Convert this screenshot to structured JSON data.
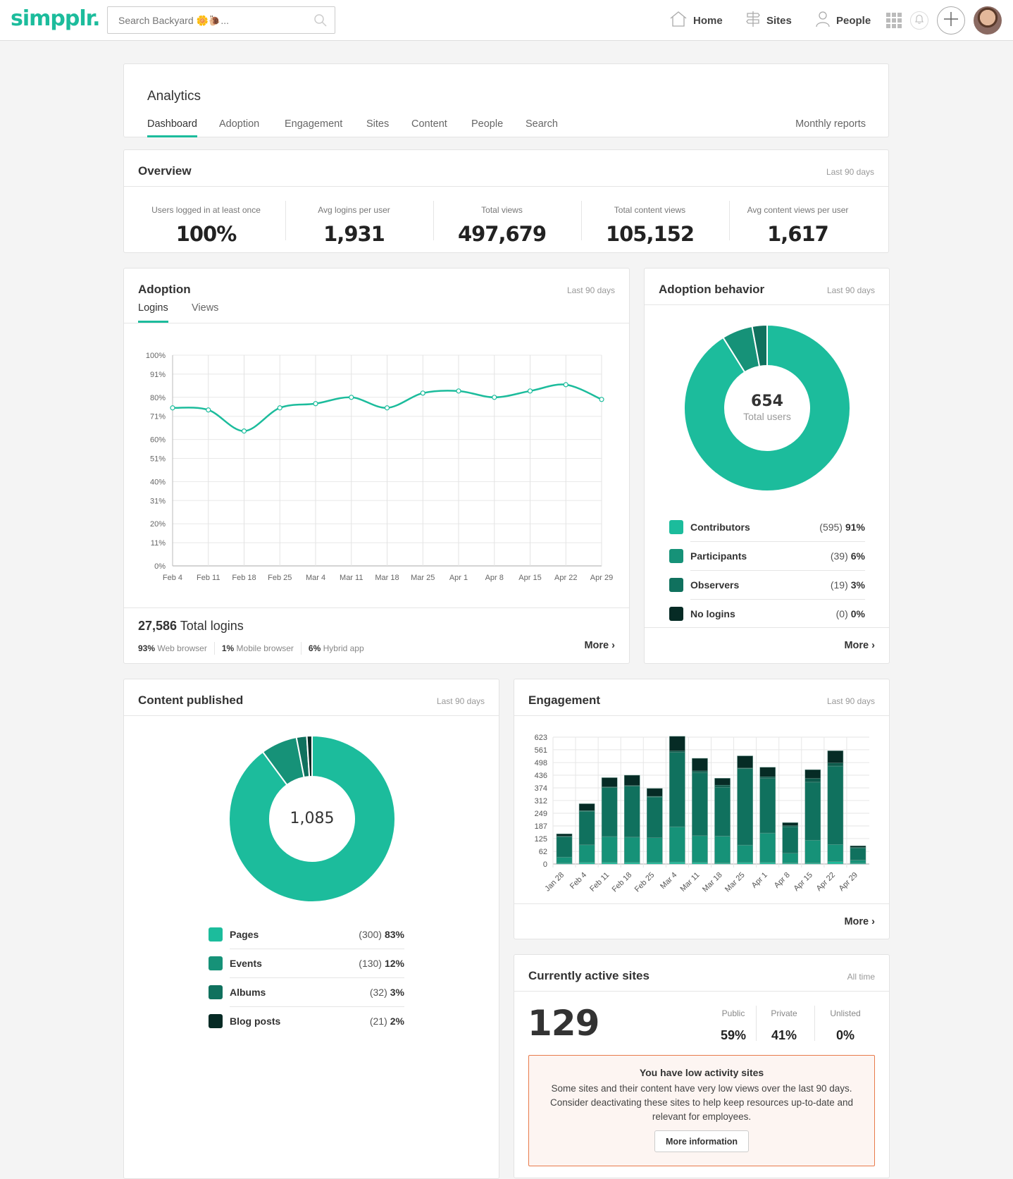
{
  "header": {
    "logo": "simpplr.",
    "search_placeholder": "Search Backyard 🌼🐌...",
    "nav": [
      {
        "label": "Home",
        "icon": "home-icon"
      },
      {
        "label": "Sites",
        "icon": "signpost-icon"
      },
      {
        "label": "People",
        "icon": "person-icon"
      }
    ]
  },
  "analytics": {
    "title": "Analytics",
    "tabs": [
      "Dashboard",
      "Adoption",
      "Engagement",
      "Sites",
      "Content",
      "People",
      "Search"
    ],
    "active_tab": "Dashboard",
    "monthly_reports": "Monthly reports"
  },
  "overview": {
    "title": "Overview",
    "period": "Last 90 days",
    "stats": [
      {
        "label": "Users logged in at least once",
        "value": "100%"
      },
      {
        "label": "Avg logins per user",
        "value": "1,931"
      },
      {
        "label": "Total views",
        "value": "497,679"
      },
      {
        "label": "Total content views",
        "value": "105,152"
      },
      {
        "label": "Avg content views per user",
        "value": "1,617"
      }
    ]
  },
  "adoption": {
    "title": "Adoption",
    "period": "Last 90 days",
    "tabs": [
      "Logins",
      "Views"
    ],
    "active_tab": "Logins",
    "total_value": "27,586",
    "total_label": "Total logins",
    "breakdown": [
      {
        "pct": "93%",
        "label": "Web browser"
      },
      {
        "pct": "1%",
        "label": "Mobile browser"
      },
      {
        "pct": "6%",
        "label": "Hybrid app"
      }
    ],
    "more": "More"
  },
  "adoption_behavior": {
    "title": "Adoption behavior",
    "period": "Last 90 days",
    "center_value": "654",
    "center_label": "Total users",
    "items": [
      {
        "name": "Contributors",
        "count": "(595)",
        "pct": "91%"
      },
      {
        "name": "Participants",
        "count": "(39)",
        "pct": "6%"
      },
      {
        "name": "Observers",
        "count": "(19)",
        "pct": "3%"
      },
      {
        "name": "No logins",
        "count": "(0)",
        "pct": "0%"
      }
    ],
    "more": "More"
  },
  "content_published": {
    "title": "Content published",
    "period": "Last 90 days",
    "center_value": "1,085",
    "items": [
      {
        "name": "Pages",
        "count": "(300)",
        "pct": "83%"
      },
      {
        "name": "Events",
        "count": "(130)",
        "pct": "12%"
      },
      {
        "name": "Albums",
        "count": "(32)",
        "pct": "3%"
      },
      {
        "name": "Blog posts",
        "count": "(21)",
        "pct": "2%"
      }
    ]
  },
  "engagement": {
    "title": "Engagement",
    "period": "Last 90 days",
    "more": "More"
  },
  "active_sites": {
    "title": "Currently active sites",
    "period": "All time",
    "count": "129",
    "breakdown": [
      {
        "label": "Public",
        "value": "59%"
      },
      {
        "label": "Private",
        "value": "41%"
      },
      {
        "label": "Unlisted",
        "value": "0%"
      }
    ],
    "alert": {
      "title": "You have low activity sites",
      "body": "Some sites and their content have very low views over the last 90 days. Consider deactivating these sites to help keep resources up-to-date and relevant for employees.",
      "button": "More information"
    }
  },
  "colors": {
    "accent": "#1cbc9c",
    "c1": "#1cbc9c",
    "c2": "#169278",
    "c3": "#10715e",
    "c4": "#062b25",
    "alert_border": "#e87a4b",
    "alert_bg": "#fdf5f2"
  },
  "chart_data": [
    {
      "type": "line",
      "title": "Adoption - Logins",
      "x": [
        "Feb 4",
        "Feb 11",
        "Feb 18",
        "Feb 25",
        "Mar 4",
        "Mar 11",
        "Mar 18",
        "Mar 25",
        "Apr 1",
        "Apr 8",
        "Apr 15",
        "Apr 22",
        "Apr 29"
      ],
      "values": [
        75,
        74,
        64,
        75,
        77,
        80,
        75,
        82,
        83,
        80,
        83,
        86,
        79
      ],
      "yticks": [
        "0%",
        "11%",
        "20%",
        "31%",
        "40%",
        "51%",
        "60%",
        "71%",
        "80%",
        "91%",
        "100%"
      ],
      "ytick_values": [
        0,
        11,
        20,
        31,
        40,
        51,
        60,
        71,
        80,
        91,
        100
      ],
      "ylim": [
        0,
        100
      ],
      "grid": true
    },
    {
      "type": "pie",
      "title": "Adoption behavior",
      "categories": [
        "Contributors",
        "Participants",
        "Observers",
        "No logins"
      ],
      "values": [
        595,
        39,
        19,
        0
      ]
    },
    {
      "type": "pie",
      "title": "Content published",
      "categories": [
        "Pages",
        "Events",
        "Albums",
        "Blog posts"
      ],
      "values": [
        300,
        130,
        32,
        21
      ],
      "note": "rendered slice proportions approx 89/7/2/1 percent"
    },
    {
      "type": "bar",
      "stacked": true,
      "title": "Engagement",
      "categories": [
        "Jan 28",
        "Feb 4",
        "Feb 11",
        "Feb 18",
        "Feb 25",
        "Mar 4",
        "Mar 11",
        "Mar 18",
        "Mar 25",
        "Apr 1",
        "Apr 8",
        "Apr 15",
        "Apr 22",
        "Apr 29"
      ],
      "yticks": [
        "0",
        "62",
        "125",
        "187",
        "249",
        "312",
        "374",
        "436",
        "498",
        "561",
        "623"
      ],
      "ylim": [
        0,
        623
      ],
      "grid": true,
      "series": [
        {
          "name": "s1",
          "values": [
            4,
            8,
            8,
            8,
            8,
            10,
            8,
            5,
            8,
            8,
            5,
            5,
            12,
            4
          ]
        },
        {
          "name": "s2",
          "values": [
            30,
            86,
            127,
            124,
            121,
            173,
            131,
            132,
            85,
            144,
            48,
            112,
            84,
            15
          ]
        },
        {
          "name": "s3",
          "values": [
            100,
            165,
            240,
            250,
            200,
            365,
            310,
            240,
            375,
            268,
            130,
            285,
            385,
            60
          ]
        },
        {
          "name": "s4",
          "values": [
            2,
            3,
            3,
            3,
            3,
            7,
            8,
            10,
            3,
            8,
            5,
            18,
            15,
            2
          ]
        },
        {
          "name": "s5",
          "values": [
            12,
            34,
            46,
            51,
            39,
            72,
            62,
            34,
            60,
            47,
            15,
            43,
            60,
            8
          ]
        }
      ]
    }
  ]
}
